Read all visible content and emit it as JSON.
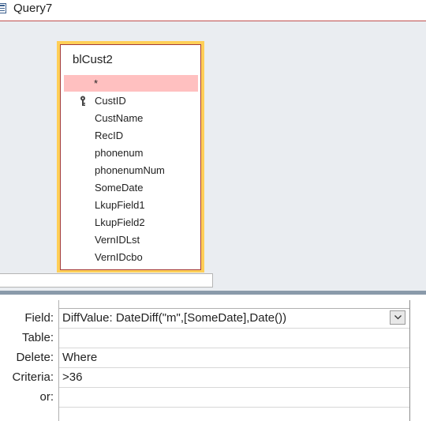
{
  "tab": {
    "title": "Query7"
  },
  "table_box": {
    "name": "blCust2",
    "fields": [
      "*",
      "CustID",
      "CustName",
      "RecID",
      "phonenum",
      "phonenumNum",
      "SomeDate",
      "LkupField1",
      "LkupField2",
      "VernIDLst",
      "VernIDcbo"
    ],
    "primary_key_field": "CustID"
  },
  "grid": {
    "row_labels": {
      "field": "Field:",
      "table": "Table:",
      "delete": "Delete:",
      "criteria": "Criteria:",
      "or": "or:"
    },
    "column1": {
      "field": "DiffValue: DateDiff(\"m\",[SomeDate],Date())",
      "table": "",
      "delete": "Where",
      "criteria": ">36",
      "or": ""
    }
  },
  "colors": {
    "accent_border": "#c0504d",
    "table_highlight": "#ffcf57",
    "selected_row": "#ffc0c0"
  }
}
